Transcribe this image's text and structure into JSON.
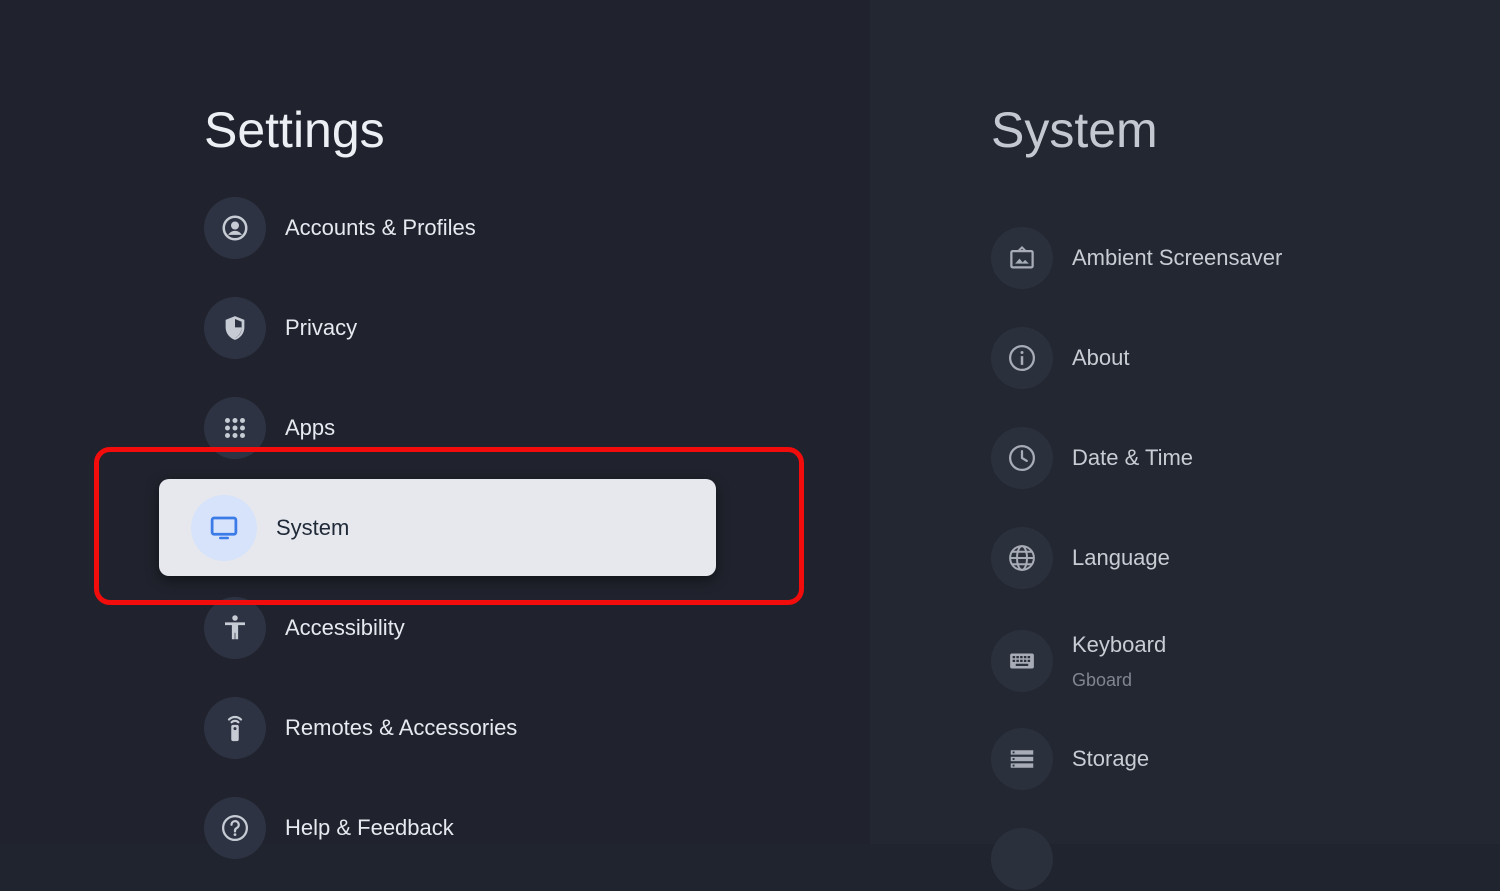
{
  "colors": {
    "background": "#20232d",
    "right_pane": "#232732",
    "icon_circle": "#2d3343",
    "selected_card": "#e6e8ee",
    "selected_icon_bg": "#d7e3fa",
    "selected_icon": "#3b7be8",
    "highlight_frame": "#f20c0c"
  },
  "left": {
    "title": "Settings",
    "items": [
      {
        "label": "Accounts & Profiles",
        "icon": "account-circle-icon"
      },
      {
        "label": "Privacy",
        "icon": "shield-icon"
      },
      {
        "label": "Apps",
        "icon": "apps-grid-icon"
      },
      {
        "label": "System",
        "icon": "tv-monitor-icon",
        "selected": true
      },
      {
        "label": "Accessibility",
        "icon": "accessibility-icon"
      },
      {
        "label": "Remotes & Accessories",
        "icon": "remote-icon"
      },
      {
        "label": "Help & Feedback",
        "icon": "help-icon"
      }
    ]
  },
  "right": {
    "title": "System",
    "items": [
      {
        "label": "Ambient Screensaver",
        "icon": "screensaver-icon"
      },
      {
        "label": "About",
        "icon": "info-icon"
      },
      {
        "label": "Date & Time",
        "icon": "clock-icon"
      },
      {
        "label": "Language",
        "icon": "globe-icon"
      },
      {
        "label": "Keyboard",
        "secondary": "Gboard",
        "icon": "keyboard-icon"
      },
      {
        "label": "Storage",
        "icon": "storage-icon"
      }
    ]
  }
}
